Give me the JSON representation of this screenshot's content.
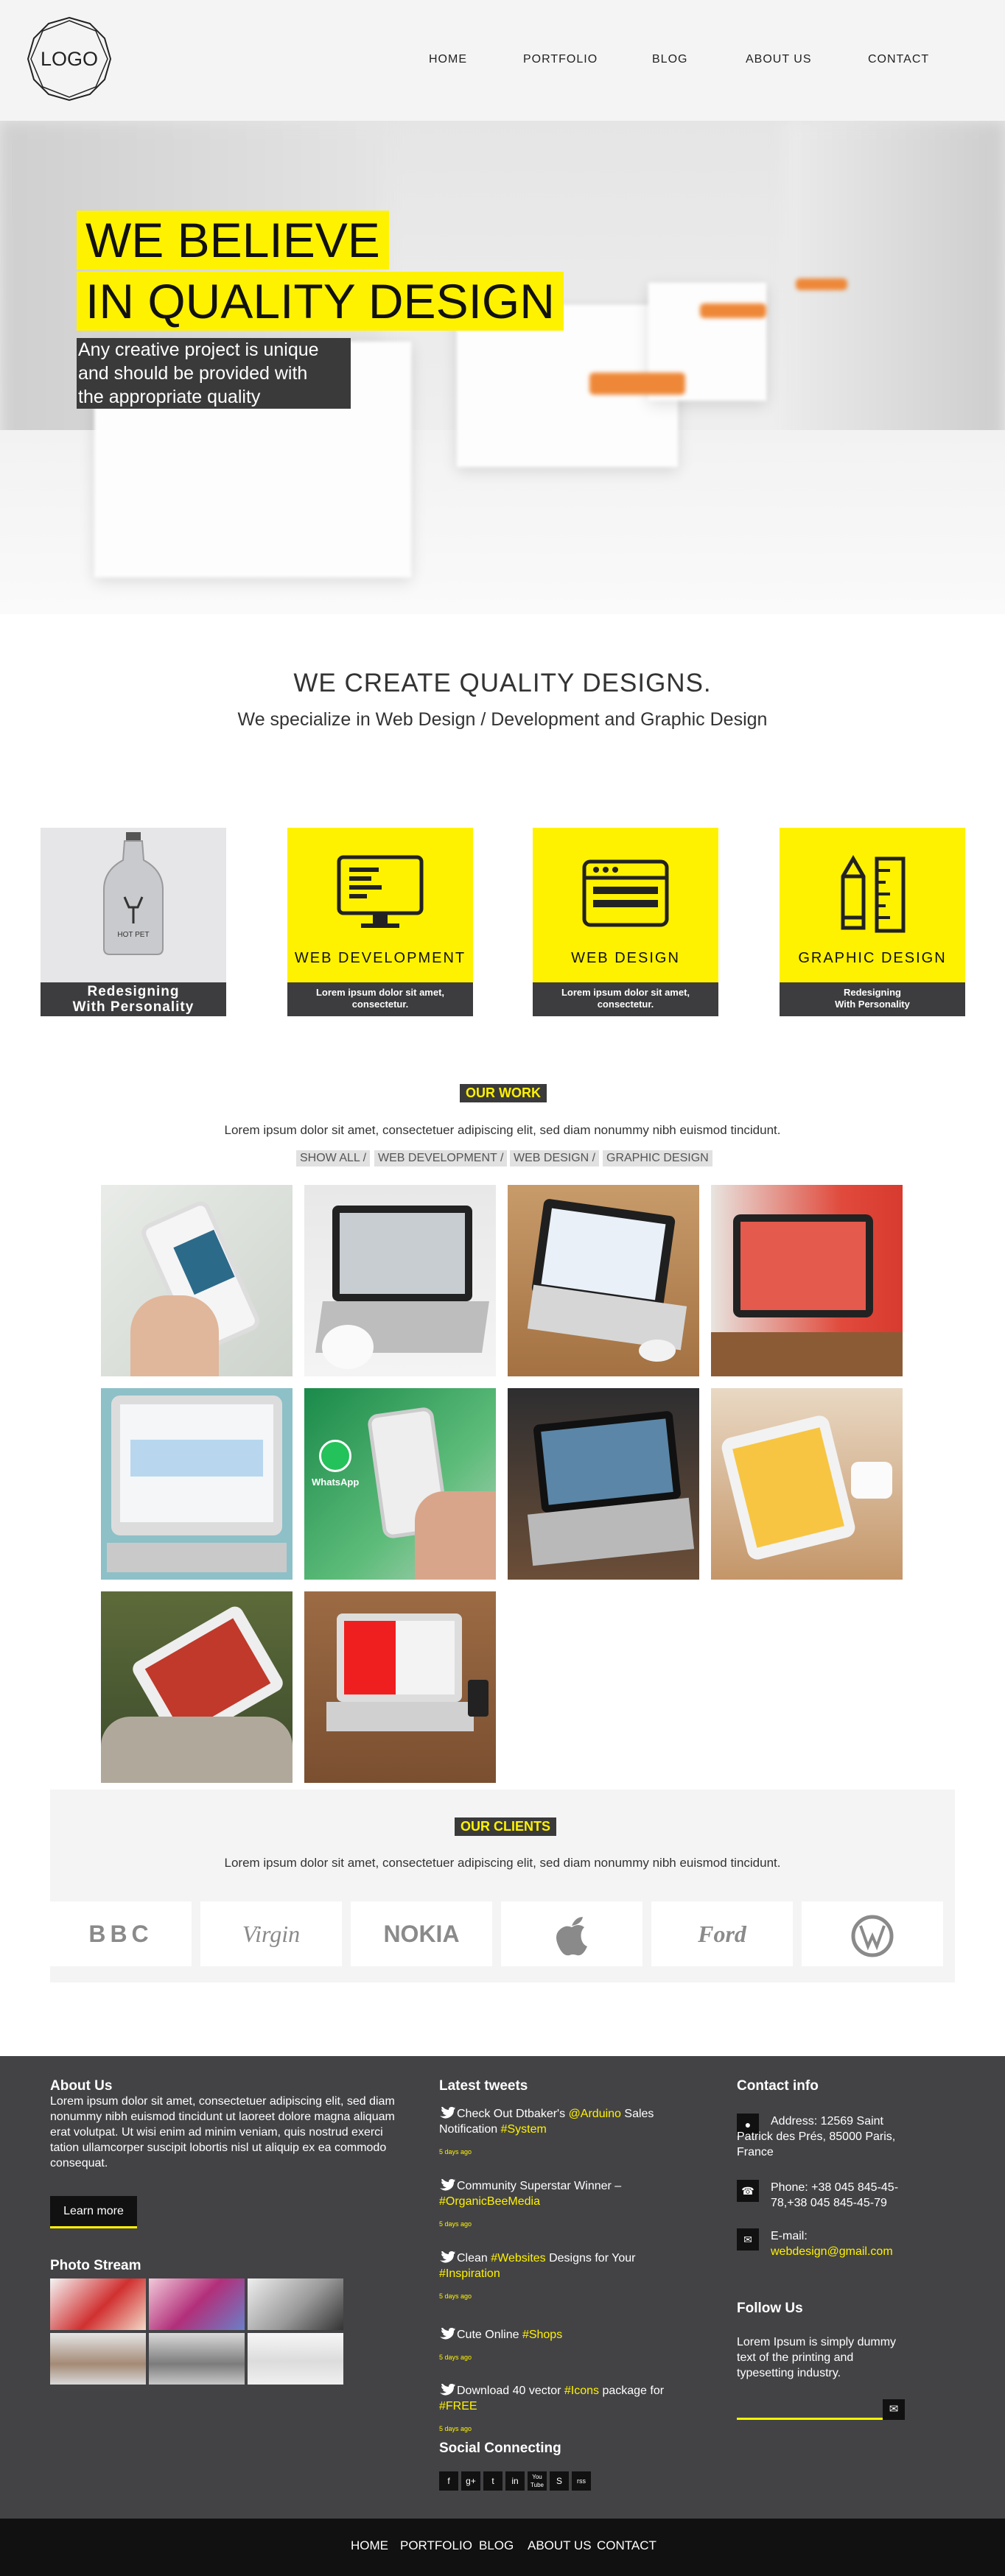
{
  "header": {
    "logo": "LOGO",
    "nav": [
      "HOME",
      "PORTFOLIO",
      "BLOG",
      "ABOUT US",
      "CONTACT"
    ]
  },
  "hero": {
    "line1": "WE BELIEVE",
    "line2": "IN QUALITY DESIGN",
    "sub": [
      "Any creative project is unique",
      "and should be provided with",
      "the appropriate quality"
    ]
  },
  "intro": {
    "title": "WE CREATE QUALITY DESIGNS.",
    "subtitle": "We specialize in Web Design / Development and Graphic Design"
  },
  "services": [
    {
      "title": "",
      "caption": "Redesigning\nWith Personality",
      "bottle_label": "HOT PET"
    },
    {
      "title": "WEB DEVELOPMENT",
      "caption": "Lorem ipsum dolor sit amet,\nconsectetur."
    },
    {
      "title": "WEB DESIGN",
      "caption": "Lorem ipsum dolor sit amet,\nconsectetur."
    },
    {
      "title": "GRAPHIC DESIGN",
      "caption": "Redesigning\nWith Personality"
    }
  ],
  "work": {
    "badge": "OUR WORK",
    "text": "Lorem ipsum dolor sit amet, consectetuer adipiscing elit, sed diam nonummy nibh euismod tincidunt.",
    "filters": [
      "SHOW ALL /",
      "WEB DEVELOPMENT /",
      "WEB DESIGN /",
      "GRAPHIC DESIGN"
    ],
    "whatsapp": "WhatsApp"
  },
  "clients": {
    "badge": "OUR CLIENTS",
    "text": "Lorem ipsum dolor sit amet, consectetuer adipiscing elit, sed diam nonummy nibh euismod tincidunt.",
    "brands": [
      "BBC",
      "Virgin",
      "NOKIA",
      "",
      "Ford",
      "VW"
    ]
  },
  "footer": {
    "about_title": "About Us",
    "about_text": "Lorem ipsum dolor sit amet, consectetuer adipiscing elit, sed diam nonummy nibh euismod tincidunt ut laoreet dolore magna aliquam erat volutpat. Ut wisi enim ad minim veniam, quis nostrud exerci tation ullamcorper suscipit lobortis nisl ut aliquip ex ea commodo consequat.",
    "learn_more": "Learn more",
    "photo_title": "Photo Stream",
    "tweets_title": "Latest tweets",
    "tweets": [
      {
        "a": "Check Out Dtbaker's ",
        "b": "@Arduino",
        "c": " Sales Notification ",
        "d": "#System",
        "ago": "5 days ago"
      },
      {
        "a": "Community Superstar Winner – ",
        "b": "#OrganicBeeMedia",
        "c": "",
        "d": "",
        "ago": "5 days ago"
      },
      {
        "a": "Clean ",
        "b": "#Websites",
        "c": " Designs for Your ",
        "d": "#Inspiration",
        "ago": "5 days ago"
      },
      {
        "a": "Cute Online ",
        "b": "#Shops",
        "c": "",
        "d": "",
        "ago": "5 days ago"
      },
      {
        "a": "Download 40 vector ",
        "b": "#Icons",
        "c": " package for ",
        "d": "#FREE",
        "ago": "5 days ago"
      }
    ],
    "social_title": "Social Connecting",
    "social": [
      "f",
      "g+",
      "t",
      "in",
      "You\nTube",
      "S",
      "rss"
    ],
    "contact_title": "Contact info",
    "address": "Address: 12569 Saint Patrick des Prés, 85000 Paris, France",
    "phone": "Phone: +38 045 845-45-78,+38 045 845-45-79",
    "email_label": "E-mail:",
    "email": "webdesign@gmail.com",
    "follow_title": "Follow Us",
    "follow_text": "Lorem Ipsum is simply dummy text of the printing and typesetting industry."
  },
  "bottom_nav": [
    "HOME",
    "PORTFOLIO",
    "BLOG",
    "ABOUT US",
    "CONTACT"
  ],
  "colors": {
    "accent": "#fff200",
    "dark": "#434346",
    "black": "#111111"
  }
}
